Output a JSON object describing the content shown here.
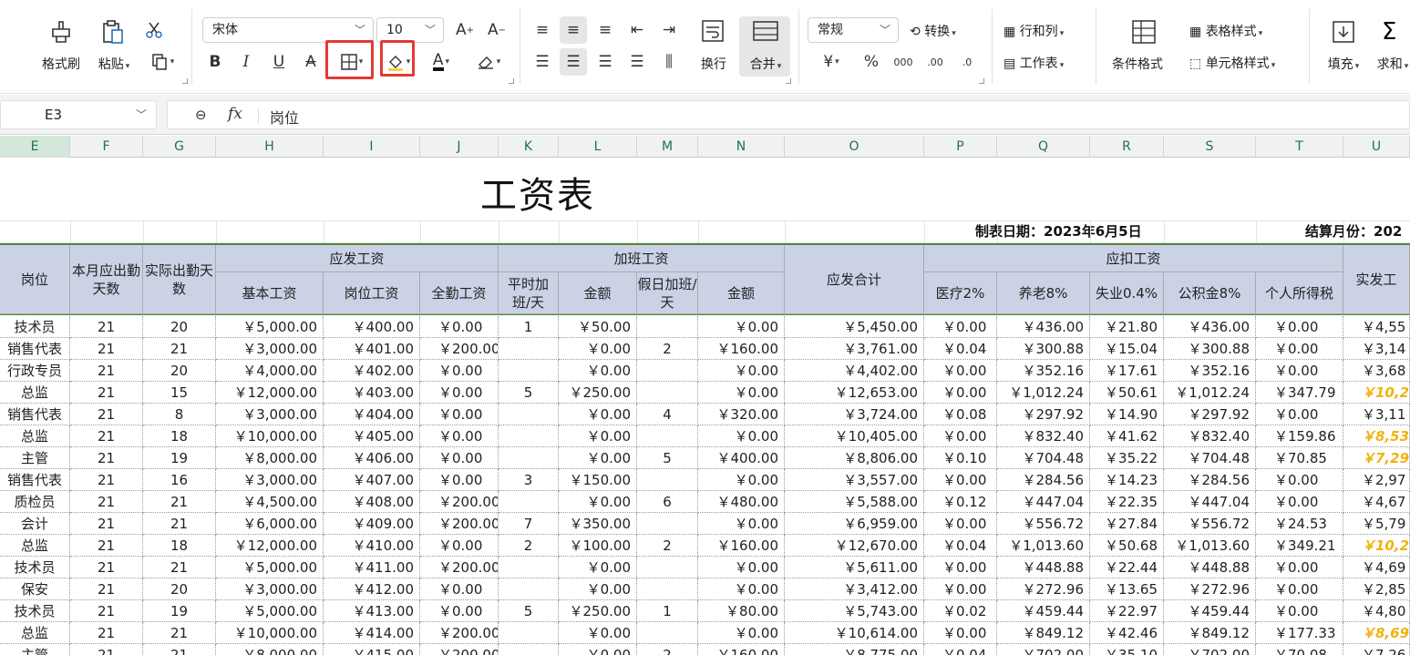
{
  "ribbon": {
    "clipboard": {
      "format_painter": "格式刷",
      "paste": "粘贴"
    },
    "font": {
      "name": "宋体",
      "size": "10"
    },
    "alignment": {
      "wrap": "换行",
      "merge": "合并"
    },
    "number": {
      "format": "常规",
      "convert": "转换"
    },
    "cells": {
      "rows_cols": "行和列",
      "worksheet": "工作表"
    },
    "styles": {
      "conditional": "条件格式",
      "table_style": "表格样式",
      "cell_style": "单元格样式"
    },
    "editing": {
      "fill": "填充",
      "sum": "求和"
    },
    "highlight_color": "#e53935"
  },
  "formula_bar": {
    "cell_ref": "E3",
    "content": "岗位"
  },
  "columns": [
    "E",
    "F",
    "G",
    "H",
    "I",
    "J",
    "K",
    "L",
    "M",
    "N",
    "O",
    "P",
    "Q",
    "R",
    "S",
    "T",
    "U"
  ],
  "sheet": {
    "title": "工资表",
    "date_label": "制表日期：2023年6月5日",
    "month_label": "结算月份：202",
    "headers": {
      "post": "岗位",
      "due_days": "本月应出勤天数",
      "actual_days": "实际出勤天数",
      "gross_group": "应发工资",
      "base": "基本工资",
      "position_pay": "岗位工资",
      "attendance": "全勤工资",
      "ot_group": "加班工资",
      "ot_weekday": "平时加班/天",
      "ot_weekday_amt": "金额",
      "ot_holiday": "假日加班/天",
      "ot_holiday_amt": "金额",
      "gross_total": "应发合计",
      "deduct_group": "应扣工资",
      "medical": "医疗2%",
      "pension": "养老8%",
      "unemployment": "失业0.4%",
      "housing": "公积金8%",
      "tax": "个人所得税",
      "net": "实发工"
    },
    "rows": [
      [
        "技术员",
        "21",
        "20",
        "￥5,000.00",
        "￥400.00",
        "￥0.00",
        "1",
        "￥50.00",
        "",
        "￥0.00",
        "￥5,450.00",
        "￥0.00",
        "￥436.00",
        "￥21.80",
        "￥436.00",
        "￥0.00",
        "￥4,55"
      ],
      [
        "销售代表",
        "21",
        "21",
        "￥3,000.00",
        "￥401.00",
        "￥200.00",
        "",
        "￥0.00",
        "2",
        "￥160.00",
        "￥3,761.00",
        "￥0.04",
        "￥300.88",
        "￥15.04",
        "￥300.88",
        "￥0.00",
        "￥3,14"
      ],
      [
        "行政专员",
        "21",
        "20",
        "￥4,000.00",
        "￥402.00",
        "￥0.00",
        "",
        "￥0.00",
        "",
        "￥0.00",
        "￥4,402.00",
        "￥0.00",
        "￥352.16",
        "￥17.61",
        "￥352.16",
        "￥0.00",
        "￥3,68"
      ],
      [
        "总监",
        "21",
        "15",
        "￥12,000.00",
        "￥403.00",
        "￥0.00",
        "5",
        "￥250.00",
        "",
        "￥0.00",
        "￥12,653.00",
        "￥0.00",
        "￥1,012.24",
        "￥50.61",
        "￥1,012.24",
        "￥347.79",
        "￥10,23"
      ],
      [
        "销售代表",
        "21",
        "8",
        "￥3,000.00",
        "￥404.00",
        "￥0.00",
        "",
        "￥0.00",
        "4",
        "￥320.00",
        "￥3,724.00",
        "￥0.08",
        "￥297.92",
        "￥14.90",
        "￥297.92",
        "￥0.00",
        "￥3,11"
      ],
      [
        "总监",
        "21",
        "18",
        "￥10,000.00",
        "￥405.00",
        "￥0.00",
        "",
        "￥0.00",
        "",
        "￥0.00",
        "￥10,405.00",
        "￥0.00",
        "￥832.40",
        "￥41.62",
        "￥832.40",
        "￥159.86",
        "￥8,53"
      ],
      [
        "主管",
        "21",
        "19",
        "￥8,000.00",
        "￥406.00",
        "￥0.00",
        "",
        "￥0.00",
        "5",
        "￥400.00",
        "￥8,806.00",
        "￥0.10",
        "￥704.48",
        "￥35.22",
        "￥704.48",
        "￥70.85",
        "￥7,29"
      ],
      [
        "销售代表",
        "21",
        "16",
        "￥3,000.00",
        "￥407.00",
        "￥0.00",
        "3",
        "￥150.00",
        "",
        "￥0.00",
        "￥3,557.00",
        "￥0.00",
        "￥284.56",
        "￥14.23",
        "￥284.56",
        "￥0.00",
        "￥2,97"
      ],
      [
        "质检员",
        "21",
        "21",
        "￥4,500.00",
        "￥408.00",
        "￥200.00",
        "",
        "￥0.00",
        "6",
        "￥480.00",
        "￥5,588.00",
        "￥0.12",
        "￥447.04",
        "￥22.35",
        "￥447.04",
        "￥0.00",
        "￥4,67"
      ],
      [
        "会计",
        "21",
        "21",
        "￥6,000.00",
        "￥409.00",
        "￥200.00",
        "7",
        "￥350.00",
        "",
        "￥0.00",
        "￥6,959.00",
        "￥0.00",
        "￥556.72",
        "￥27.84",
        "￥556.72",
        "￥24.53",
        "￥5,79"
      ],
      [
        "总监",
        "21",
        "18",
        "￥12,000.00",
        "￥410.00",
        "￥0.00",
        "2",
        "￥100.00",
        "2",
        "￥160.00",
        "￥12,670.00",
        "￥0.04",
        "￥1,013.60",
        "￥50.68",
        "￥1,013.60",
        "￥349.21",
        "￥10,24"
      ],
      [
        "技术员",
        "21",
        "21",
        "￥5,000.00",
        "￥411.00",
        "￥200.00",
        "",
        "￥0.00",
        "",
        "￥0.00",
        "￥5,611.00",
        "￥0.00",
        "￥448.88",
        "￥22.44",
        "￥448.88",
        "￥0.00",
        "￥4,69"
      ],
      [
        "保安",
        "21",
        "20",
        "￥3,000.00",
        "￥412.00",
        "￥0.00",
        "",
        "￥0.00",
        "",
        "￥0.00",
        "￥3,412.00",
        "￥0.00",
        "￥272.96",
        "￥13.65",
        "￥272.96",
        "￥0.00",
        "￥2,85"
      ],
      [
        "技术员",
        "21",
        "19",
        "￥5,000.00",
        "￥413.00",
        "￥0.00",
        "5",
        "￥250.00",
        "1",
        "￥80.00",
        "￥5,743.00",
        "￥0.02",
        "￥459.44",
        "￥22.97",
        "￥459.44",
        "￥0.00",
        "￥4,80"
      ],
      [
        "总监",
        "21",
        "21",
        "￥10,000.00",
        "￥414.00",
        "￥200.00",
        "",
        "￥0.00",
        "",
        "￥0.00",
        "￥10,614.00",
        "￥0.00",
        "￥849.12",
        "￥42.46",
        "￥849.12",
        "￥177.33",
        "￥8,69"
      ],
      [
        "主管",
        "21",
        "21",
        "￥8,000.00",
        "￥415.00",
        "￥200.00",
        "",
        "￥0.00",
        "2",
        "￥160.00",
        "￥8,775.00",
        "￥0.04",
        "￥702.00",
        "￥35.10",
        "￥702.00",
        "￥70.08",
        "￥7,26"
      ]
    ],
    "highlight_rows": [
      3,
      5,
      6,
      10,
      14
    ],
    "highlight_color": "#f2b10f",
    "header_bg": "#ccd2e6",
    "accent_green": "#4f8a3a"
  }
}
